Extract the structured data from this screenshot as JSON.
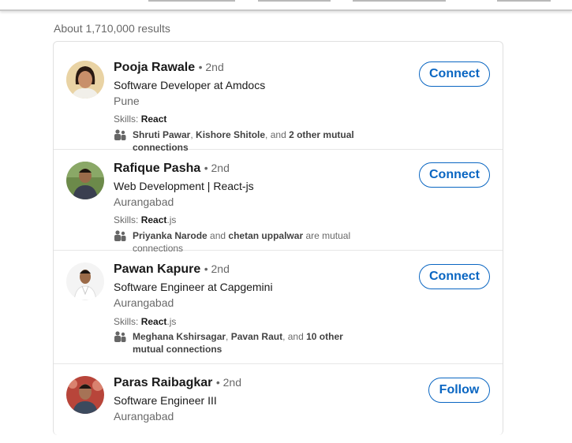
{
  "results_count": "About 1,710,000 results",
  "colors": {
    "accent": "#0a66c2",
    "border": "#e0e0e0"
  },
  "people": [
    {
      "name": "Pooja Rawale",
      "degree": "• 2nd",
      "headline": "Software Developer at Amdocs",
      "location": "Pune",
      "skills_label": "Skills:",
      "skills_bold": "React",
      "skills_rest": "",
      "mutual": {
        "icon": "people-icon",
        "p1": "Shruti Pawar",
        "sep1": ", ",
        "p2": "Kishore Shitole",
        "sep2": ", and ",
        "p3": "2 other mutual connections",
        "tail": ""
      },
      "action": "Connect"
    },
    {
      "name": "Rafique Pasha",
      "degree": "• 2nd",
      "headline": "Web Development | React-js",
      "location": "Aurangabad",
      "skills_label": "Skills:",
      "skills_bold": "React",
      "skills_rest": ".js",
      "mutual": {
        "icon": "people-icon",
        "p1": "Priyanka Narode",
        "sep1": " and ",
        "p2": "chetan uppalwar",
        "sep2": " are mutual connections",
        "p3": "",
        "tail": ""
      },
      "action": "Connect"
    },
    {
      "name": "Pawan Kapure",
      "degree": "• 2nd",
      "headline": "Software Engineer at Capgemini",
      "location": "Aurangabad",
      "skills_label": "Skills:",
      "skills_bold": "React",
      "skills_rest": ".js",
      "mutual": {
        "icon": "people-icon",
        "p1": "Meghana Kshirsagar",
        "sep1": ", ",
        "p2": "Pavan Raut",
        "sep2": ", and ",
        "p3": "10 other mutual connections",
        "tail": ""
      },
      "action": "Connect"
    },
    {
      "name": "Paras Raibagkar",
      "degree": "• 2nd",
      "headline": "Software Engineer III",
      "location": "Aurangabad",
      "action": "Follow"
    }
  ]
}
